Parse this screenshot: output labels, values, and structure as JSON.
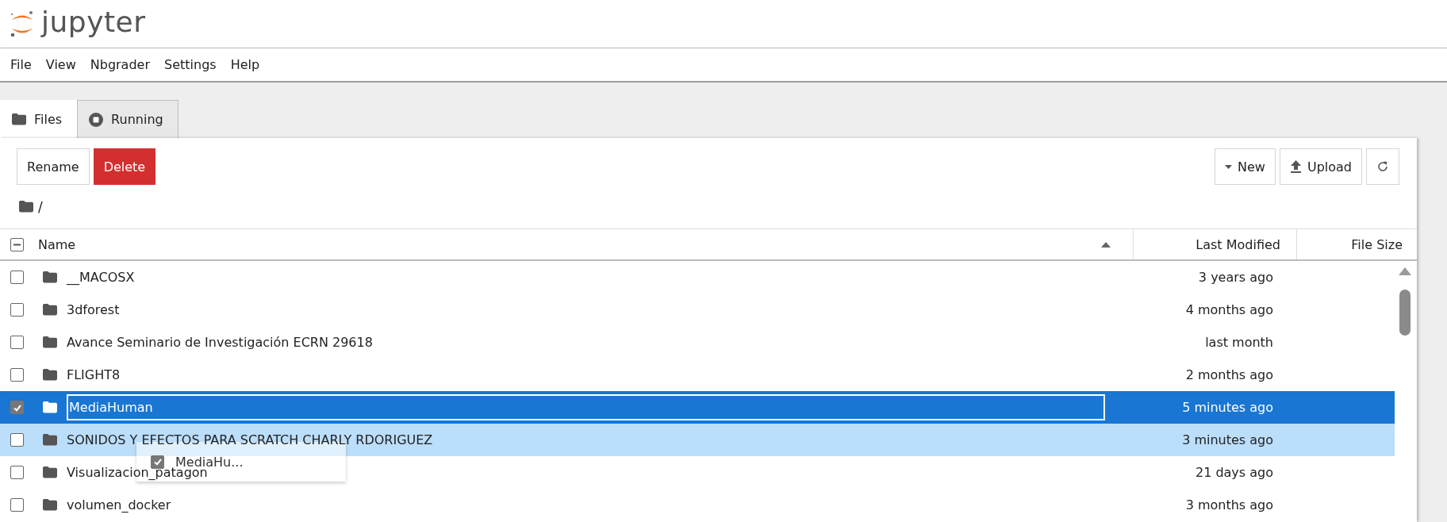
{
  "app": {
    "logo_text": "jupyter"
  },
  "menu": [
    "File",
    "View",
    "Nbgrader",
    "Settings",
    "Help"
  ],
  "tabs": [
    {
      "label": "Files",
      "kind": "files",
      "selected": true
    },
    {
      "label": "Running",
      "kind": "running",
      "selected": false
    }
  ],
  "toolbar": {
    "left": [
      {
        "label": "Rename",
        "kind": "default"
      },
      {
        "label": "Delete",
        "kind": "danger"
      }
    ],
    "right": [
      {
        "label": "New",
        "kind": "dropdown"
      },
      {
        "label": "Upload",
        "kind": "upload"
      },
      {
        "kind": "refresh"
      }
    ]
  },
  "breadcrumb": "/",
  "table": {
    "select_all_mixed": true,
    "columns": [
      {
        "label": "Name",
        "sorted": true
      },
      {
        "label": "Last Modified",
        "sorted": false
      },
      {
        "label": "File Size",
        "sorted": false
      }
    ],
    "rows": [
      {
        "name": "__MACOSX",
        "modified": "3 years ago",
        "checked": false,
        "selected": false,
        "highlighted": false,
        "editing": false
      },
      {
        "name": "3dforest",
        "modified": "4 months ago",
        "checked": false,
        "selected": false,
        "highlighted": false,
        "editing": false
      },
      {
        "name": "Avance Seminario de Investigación ECRN 29618",
        "modified": "last month",
        "checked": false,
        "selected": false,
        "highlighted": false,
        "editing": false
      },
      {
        "name": "FLIGHT8",
        "modified": "2 months ago",
        "checked": false,
        "selected": false,
        "highlighted": false,
        "editing": false
      },
      {
        "name": "MediaHuman",
        "modified": "5 minutes ago",
        "checked": true,
        "selected": true,
        "highlighted": false,
        "editing": true
      },
      {
        "name": "SONIDOS Y EFECTOS PARA SCRATCH CHARLY RDORIGUEZ",
        "modified": "3 minutes ago",
        "checked": false,
        "selected": false,
        "highlighted": true,
        "editing": false
      },
      {
        "name": "Visualizacion_patagon",
        "modified": "21 days ago",
        "checked": false,
        "selected": false,
        "highlighted": false,
        "editing": false
      },
      {
        "name": "volumen_docker",
        "modified": "3 months ago",
        "checked": false,
        "selected": false,
        "highlighted": false,
        "editing": false
      }
    ]
  },
  "drag_ghost": {
    "label": "MediaHu...",
    "checked": true
  }
}
